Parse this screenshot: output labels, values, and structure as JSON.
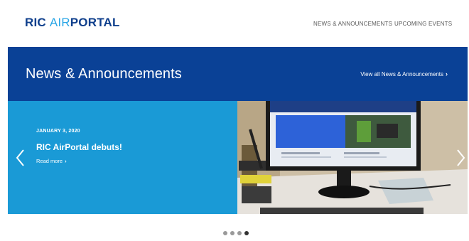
{
  "header": {
    "logo": {
      "part1": "RIC ",
      "part2": "AIR",
      "part3": "PORTAL"
    },
    "nav": [
      {
        "label": "NEWS & ANNOUNCEMENTS"
      },
      {
        "label": "UPCOMING EVENTS"
      }
    ]
  },
  "news_band": {
    "title": "News & Announcements",
    "view_all_label": "View all News & Announcements"
  },
  "carousel": {
    "slide": {
      "date": "JANUARY 3, 2020",
      "headline": "RIC AirPortal debuts!",
      "read_more_label": "Read more"
    },
    "active_index": 3,
    "slide_count": 4
  },
  "colors": {
    "brand_navy": "#0a4196",
    "brand_light_blue": "#1a9ad6",
    "logo_accent": "#2aa6e6"
  }
}
